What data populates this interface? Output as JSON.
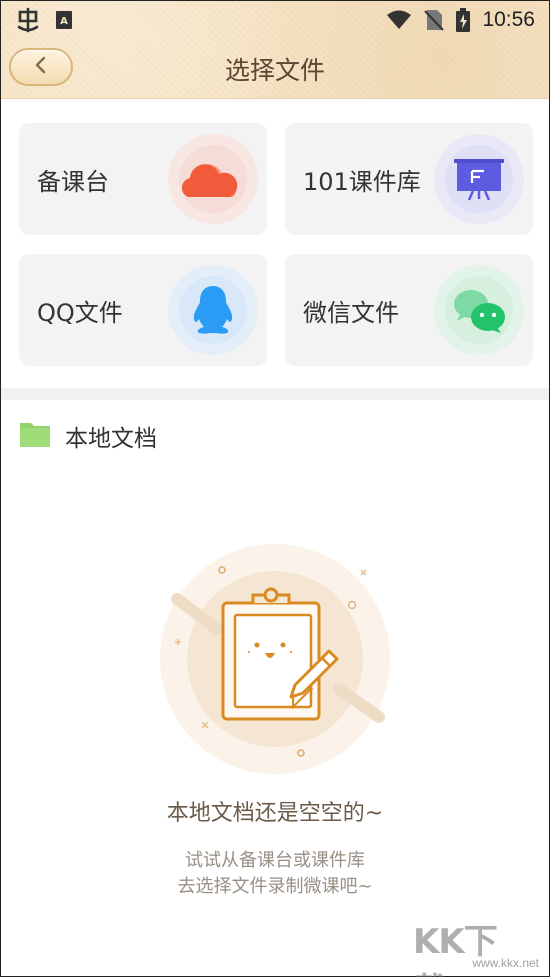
{
  "status_bar": {
    "time": "10:56",
    "icons": [
      "app-logo-icon",
      "a-badge-icon",
      "wifi-icon",
      "no-sim-icon",
      "battery-charging-icon"
    ]
  },
  "header": {
    "title": "选择文件",
    "back_icon": "chevron-left-icon"
  },
  "sources": [
    {
      "label": "备课台",
      "icon": "cloud-icon",
      "accent": "#f25a3c"
    },
    {
      "label": "101课件库",
      "icon": "presentation-board-icon",
      "accent": "#5b5ce0"
    },
    {
      "label": "QQ文件",
      "icon": "qq-penguin-icon",
      "accent": "#2a9cf5"
    },
    {
      "label": "微信文件",
      "icon": "wechat-icon",
      "accent": "#22c36a"
    }
  ],
  "local": {
    "icon": "folder-icon",
    "title": "本地文档",
    "folder_color": "#8fd36a"
  },
  "empty_state": {
    "illustration": "clipboard-pencil-icon",
    "title": "本地文档还是空空的~",
    "subtitle_line1": "试试从备课台或课件库",
    "subtitle_line2": "去选择文件录制微课吧~"
  },
  "watermark": {
    "text": "KK下载",
    "url": "www.kkx.net"
  }
}
